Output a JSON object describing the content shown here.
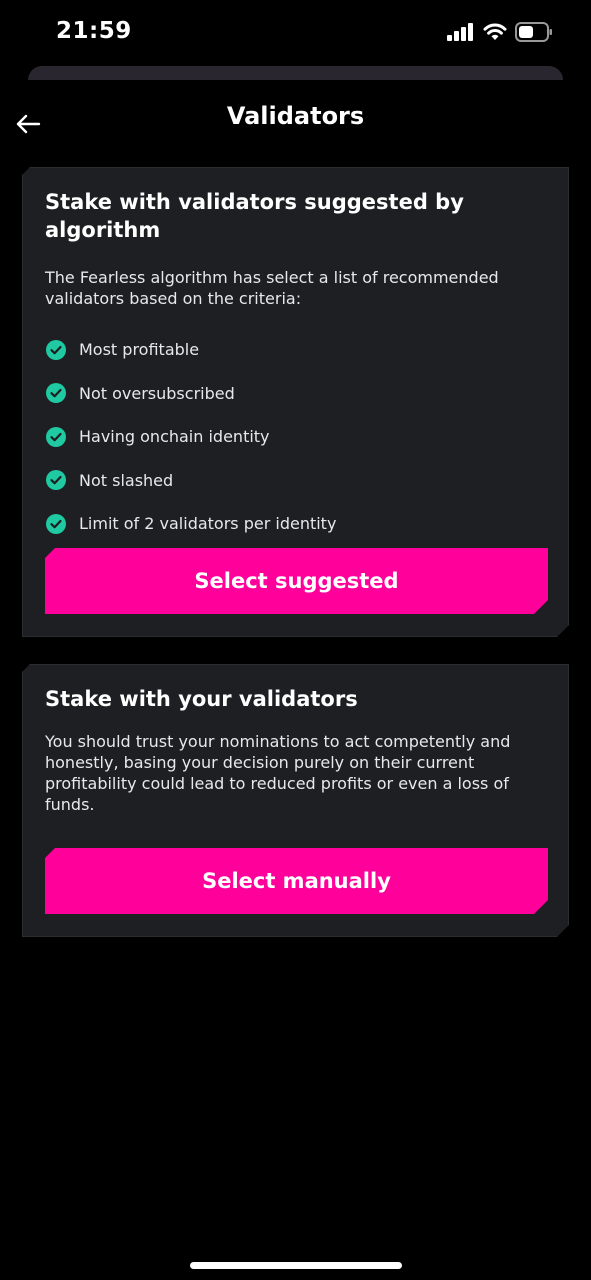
{
  "status_bar": {
    "time": "21:59"
  },
  "header": {
    "title": "Validators",
    "back_icon": "arrow-left-icon"
  },
  "suggested_card": {
    "title": "Stake with validators suggested by algorithm",
    "description": "The Fearless algorithm has select a list of recommended validators based on the criteria:",
    "criteria": [
      "Most profitable",
      "Not oversubscribed",
      "Having onchain identity",
      "Not slashed",
      "Limit of 2 validators per identity"
    ],
    "button_label": "Select suggested"
  },
  "manual_card": {
    "title": "Stake with your validators",
    "description": "You should trust your nominations to act competently and honestly, basing your decision purely on their current profitability could lead to reduced profits or even a loss of funds.",
    "button_label": "Select manually"
  },
  "colors": {
    "accent": "#ff009a",
    "check": "#1fc9a1",
    "card_bg": "#1e1f22",
    "background": "#000000"
  }
}
